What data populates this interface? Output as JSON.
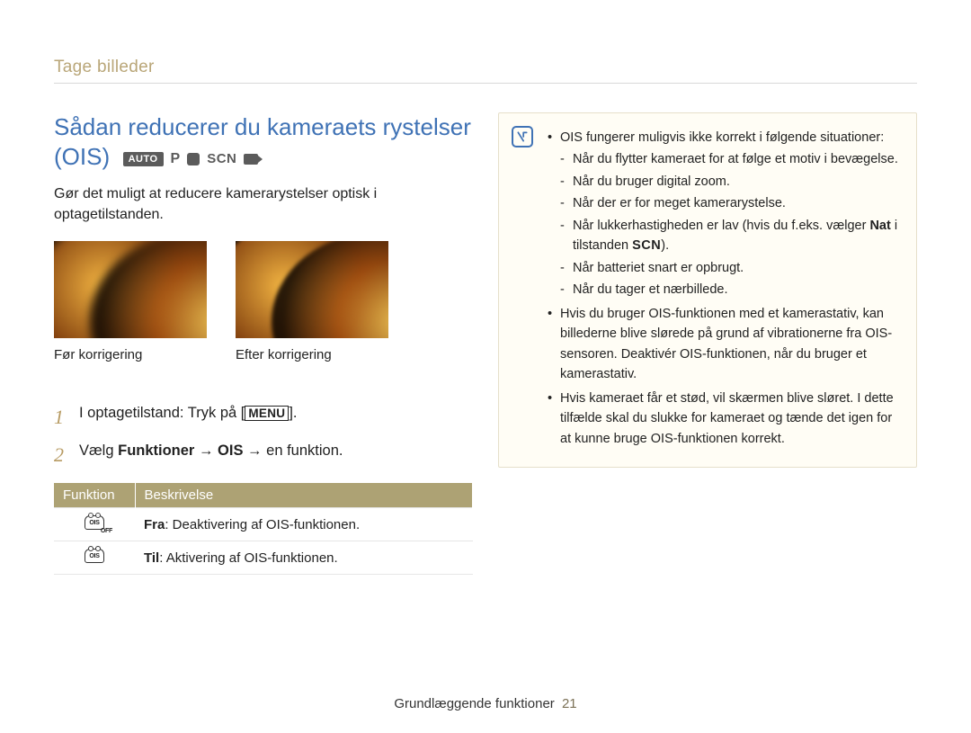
{
  "breadcrumb": "Tage billeder",
  "title_line1": "Sådan reducerer du kameraets rystelser",
  "title_line2": "(OIS)",
  "modes": {
    "auto": "AUTO",
    "p": "P",
    "scn": "SCN"
  },
  "intro": "Gør det muligt at reducere kamerarystelser optisk i optagetilstanden.",
  "photos": {
    "before": "Før korrigering",
    "after": "Efter korrigering"
  },
  "steps": {
    "s1_pre": "I optagetilstand: Tryk på [",
    "s1_menu": "MENU",
    "s1_post": "].",
    "s2_pre": "Vælg ",
    "s2_bold1": "Funktioner",
    "s2_arrow1": " → ",
    "s2_bold2": "OIS",
    "s2_arrow2": " → ",
    "s2_post": "en funktion."
  },
  "table": {
    "h1": "Funktion",
    "h2": "Beskrivelse",
    "r1_bold": "Fra",
    "r1_rest": ": Deaktivering af OIS-funktionen.",
    "r2_bold": "Til",
    "r2_rest": ": Aktivering af OIS-funktionen.",
    "off_sub": "OFF",
    "ois_inner": "OIS"
  },
  "note": {
    "b1": "OIS fungerer muligvis ikke korrekt i følgende situationer:",
    "b1_s1": "Når du flytter kameraet for at følge et motiv i bevægelse.",
    "b1_s2": "Når du bruger digital zoom.",
    "b1_s3": "Når der er for meget kamerarystelse.",
    "b1_s4_pre": "Når lukkerhastigheden er lav (hvis du f.eks. vælger ",
    "b1_s4_bold": "Nat",
    "b1_s4_mid": " i tilstanden ",
    "b1_s4_scn": "SCN",
    "b1_s4_post": ".",
    "b1_s5": "Når batteriet snart er opbrugt.",
    "b1_s6": "Når du tager et nærbillede.",
    "b2": "Hvis du bruger OIS-funktionen med et kamerastativ, kan billederne blive slørede på grund af vibrationerne fra OIS-sensoren. Deaktivér OIS-funktionen, når du bruger et kamerastativ.",
    "b3": "Hvis kameraet får et stød, vil skærmen blive sløret. I dette tilfælde skal du slukke for kameraet og tænde det igen for at kunne bruge OIS-funktionen korrekt."
  },
  "footer": {
    "label": "Grundlæggende funktioner",
    "page": "21"
  }
}
